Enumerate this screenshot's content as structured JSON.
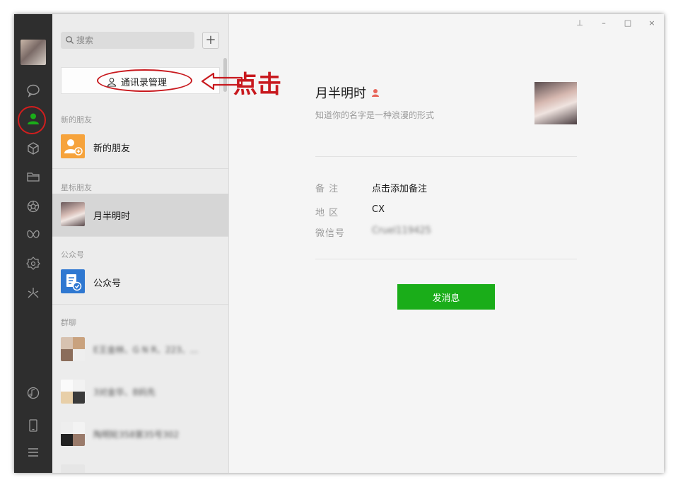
{
  "window": {
    "controls": [
      "⊥",
      "–",
      "□",
      "×"
    ]
  },
  "search": {
    "placeholder": "搜索",
    "add_label": "+"
  },
  "manage_button": {
    "label": "通讯录管理"
  },
  "annotation": {
    "text": "点击"
  },
  "sections": {
    "new_friends": "新的朋友",
    "starred": "星标朋友",
    "official": "公众号",
    "groups": "群聊"
  },
  "rows": {
    "new_friends": "新的朋友",
    "starred_contact": "月半明时",
    "official": "公众号",
    "group1": "E王金林、G N R、223、...",
    "group2": "3对金华、B妈先",
    "group3": "陶明轮358第35号302"
  },
  "profile": {
    "name": "月半明时",
    "signature": "知道你的名字是一种浪漫的形式",
    "remark_label": "备  注",
    "remark_value": "点击添加备注",
    "region_label": "地  区",
    "region_value": "CX",
    "wechat_label": "微信号",
    "wechat_value": "Cruel119425",
    "send_button": "发消息"
  },
  "colors": {
    "accent": "#1aad19",
    "annotation": "#c8191e",
    "sidebar": "#2e2e2e"
  }
}
